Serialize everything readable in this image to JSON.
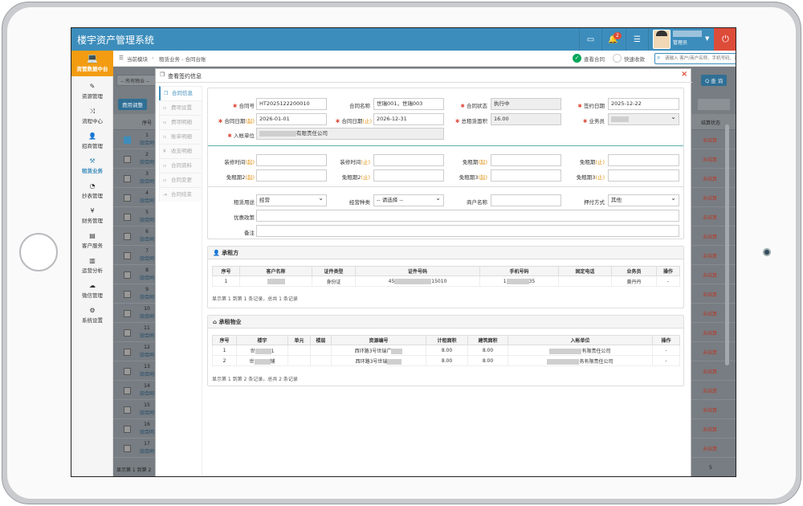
{
  "app": {
    "title": "楼宇资产管理系统",
    "notification_count": "2",
    "user_role": "管理员"
  },
  "sidebar": {
    "top_label": "资管数据中台",
    "items": [
      {
        "label": "资源管理",
        "icon": "edit-icon"
      },
      {
        "label": "流程中心",
        "icon": "shuffle-icon"
      },
      {
        "label": "招商管理",
        "icon": "user-plus-icon"
      },
      {
        "label": "租赁业务",
        "icon": "gavel-icon"
      },
      {
        "label": "抄表管理",
        "icon": "dashboard-icon"
      },
      {
        "label": "财务管理",
        "icon": "yen-icon"
      },
      {
        "label": "客户服务",
        "icon": "printer-icon"
      },
      {
        "label": "运营分析",
        "icon": "bar-chart-icon"
      },
      {
        "label": "微信管理",
        "icon": "wechat-icon"
      },
      {
        "label": "系统设置",
        "icon": "cogs-icon"
      }
    ]
  },
  "breadcrumb": {
    "root": "当前模块",
    "path": "租赁业务 - 合同台账"
  },
  "toolbar": {
    "view_contract": "查看合同",
    "quick_collect": "快速收款",
    "search_placeholder": "请输入 客户/商户名称、手机号码、资源编号..."
  },
  "background": {
    "property_filter": "-- 所有物业 --",
    "query_button": "Q 查 询",
    "fee_adjust_button": "费用调整",
    "col_seq": "序号",
    "col_status": "结算状态",
    "row_text": "旧合同",
    "row_status": "未结算",
    "rows": [
      "1",
      "2",
      "3",
      "4",
      "5",
      "6",
      "7",
      "8",
      "9",
      "10",
      "11",
      "12",
      "13",
      "14",
      "15",
      "16",
      "17"
    ],
    "footer": "显示第 1 到第 2",
    "pager": "5"
  },
  "modal": {
    "title": "查看签约信息",
    "tabs": [
      "合同信息",
      "费项设置",
      "费项明细",
      "账单明细",
      "收支明细",
      "合同资料",
      "合同变更",
      "合同结束"
    ],
    "labels": {
      "contract_no": "合同号",
      "contract_name": "合同名称",
      "contract_status": "合同状态",
      "sign_date": "签约日期",
      "contract_date_start": "合同日期",
      "contract_date_end": "合同日期",
      "total_area": "总租赁面积",
      "salesman": "业务员",
      "entry_unit": "入帐单位",
      "decor_time_start": "装修时间",
      "decor_time_end": "装修时间",
      "free_period_start": "免租期",
      "free_period_end": "免租期",
      "free_period2_start": "免租期2",
      "free_period2_end": "免租期2",
      "free_period3_start": "免租期3",
      "free_period3_end": "免租期3",
      "lease_use": "租赁用途",
      "business_category": "经营种类",
      "merchant_name": "商户名称",
      "payment_method": "押付方式",
      "discount_policy": "优惠政策",
      "remark": "备注",
      "tag_start": "(起)",
      "tag_end": "(止)"
    },
    "values": {
      "contract_no": "HT2025122200010",
      "contract_name": "世瑞001，世瑞003",
      "contract_status": "执行中",
      "sign_date": "2025-12-22",
      "contract_date_start": "2026-01-01",
      "contract_date_end": "2026-12-31",
      "total_area": "16.00",
      "entry_unit_suffix": "有限责任公司",
      "lease_use": "经营",
      "business_category": "-- 请选择 --",
      "payment_method": "其他"
    },
    "tenant": {
      "section_title": "承租方",
      "headers": [
        "序号",
        "客户名称",
        "证件类型",
        "证件号码",
        "手机号码",
        "固定电话",
        "业务员",
        "操作"
      ],
      "rows": [
        {
          "seq": "1",
          "id_type": "身份证",
          "id_prefix": "45",
          "id_suffix": "15010",
          "phone_prefix": "1",
          "phone_suffix": "35",
          "salesman": "黄丹丹",
          "op": "-"
        }
      ],
      "footer": "显示第 1 到第 1 条记录，总共 1 条记录"
    },
    "property": {
      "section_title": "承租物业",
      "headers": [
        "序号",
        "楼宇",
        "单元",
        "楼层",
        "资源编号",
        "计租面积",
        "建筑面积",
        "入帐单位",
        "操作"
      ],
      "rows": [
        {
          "seq": "1",
          "building_prefix": "世",
          "building_suffix": "1",
          "resource": "西环路3号世瑞广",
          "rent_area": "8.00",
          "build_area": "8.00",
          "unit_suffix": "有限责任公司",
          "op": "-"
        },
        {
          "seq": "2",
          "building_prefix": "世",
          "building_suffix": "铺",
          "resource": "西环路3号世瑞",
          "rent_area": "8.00",
          "build_area": "8.00",
          "unit_suffix": "务有限责任公司",
          "op": "-"
        }
      ],
      "footer": "显示第 1 到第 2 条记录，总共 2 条记录"
    }
  }
}
